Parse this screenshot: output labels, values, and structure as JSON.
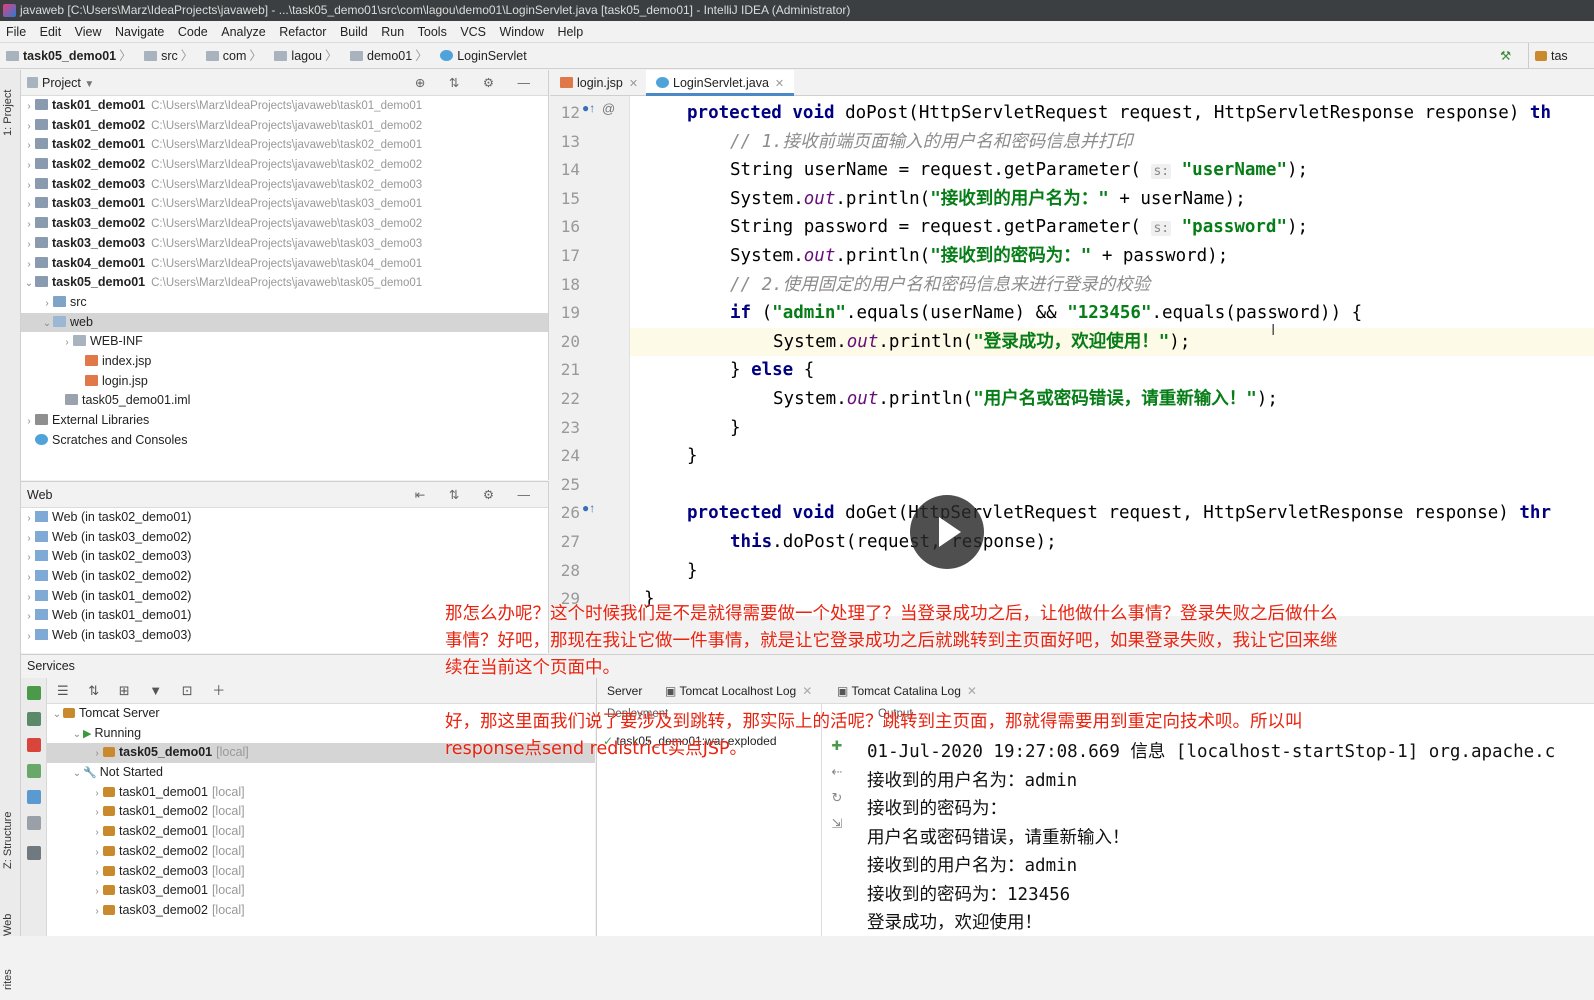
{
  "window": {
    "title": "javaweb [C:\\Users\\Marz\\IdeaProjects\\javaweb] - ...\\task05_demo01\\src\\com\\lagou\\demo01\\LoginServlet.java [task05_demo01] - IntelliJ IDEA (Administrator)"
  },
  "menu": [
    "File",
    "Edit",
    "View",
    "Navigate",
    "Code",
    "Analyze",
    "Refactor",
    "Build",
    "Run",
    "Tools",
    "VCS",
    "Window",
    "Help"
  ],
  "breadcrumb": [
    "task05_demo01",
    "src",
    "com",
    "lagou",
    "demo01",
    "LoginServlet"
  ],
  "nav_right_label": "tas",
  "project_panel": {
    "title": "Project",
    "items": [
      {
        "name": "task01_demo01",
        "path": "C:\\Users\\Marz\\IdeaProjects\\javaweb\\task01_demo01"
      },
      {
        "name": "task01_demo02",
        "path": "C:\\Users\\Marz\\IdeaProjects\\javaweb\\task01_demo02"
      },
      {
        "name": "task02_demo01",
        "path": "C:\\Users\\Marz\\IdeaProjects\\javaweb\\task02_demo01"
      },
      {
        "name": "task02_demo02",
        "path": "C:\\Users\\Marz\\IdeaProjects\\javaweb\\task02_demo02"
      },
      {
        "name": "task02_demo03",
        "path": "C:\\Users\\Marz\\IdeaProjects\\javaweb\\task02_demo03"
      },
      {
        "name": "task03_demo01",
        "path": "C:\\Users\\Marz\\IdeaProjects\\javaweb\\task03_demo01"
      },
      {
        "name": "task03_demo02",
        "path": "C:\\Users\\Marz\\IdeaProjects\\javaweb\\task03_demo02"
      },
      {
        "name": "task03_demo03",
        "path": "C:\\Users\\Marz\\IdeaProjects\\javaweb\\task03_demo03"
      },
      {
        "name": "task04_demo01",
        "path": "C:\\Users\\Marz\\IdeaProjects\\javaweb\\task04_demo01"
      },
      {
        "name": "task05_demo01",
        "path": "C:\\Users\\Marz\\IdeaProjects\\javaweb\\task05_demo01"
      }
    ],
    "src": "src",
    "web": "web",
    "web_inf": "WEB-INF",
    "index_jsp": "index.jsp",
    "login_jsp": "login.jsp",
    "iml": "task05_demo01.iml",
    "external_libs": "External Libraries",
    "scratches": "Scratches and Consoles"
  },
  "web_panel": {
    "title": "Web",
    "items": [
      "Web (in task02_demo01)",
      "Web (in task03_demo02)",
      "Web (in task02_demo03)",
      "Web (in task02_demo02)",
      "Web (in task01_demo02)",
      "Web (in task01_demo01)",
      "Web (in task03_demo03)"
    ]
  },
  "side_labels": {
    "project": "1: Project",
    "structure": "Z: Structure",
    "web": "Web",
    "favorites": "rites"
  },
  "editor": {
    "tabs": [
      {
        "label": "login.jsp"
      },
      {
        "label": "LoginServlet.java"
      }
    ],
    "line_numbers": [
      "12",
      "13",
      "14",
      "15",
      "16",
      "17",
      "18",
      "19",
      "20",
      "21",
      "22",
      "23",
      "24",
      "25",
      "26",
      "27",
      "28",
      "29"
    ]
  },
  "services": {
    "title": "Services",
    "tomcat_server": "Tomcat Server",
    "running": "Running",
    "running_items": [
      {
        "name": "task05_demo01",
        "tag": "[local]"
      }
    ],
    "not_started": "Not Started",
    "not_started_items": [
      {
        "name": "task01_demo01",
        "tag": "[local]"
      },
      {
        "name": "task01_demo02",
        "tag": "[local]"
      },
      {
        "name": "task02_demo01",
        "tag": "[local]"
      },
      {
        "name": "task02_demo02",
        "tag": "[local]"
      },
      {
        "name": "task02_demo03",
        "tag": "[local]"
      },
      {
        "name": "task03_demo01",
        "tag": "[local]"
      },
      {
        "name": "task03_demo02",
        "tag": "[local]"
      }
    ],
    "tabs": [
      "Server",
      "Tomcat Localhost Log",
      "Tomcat Catalina Log"
    ],
    "deployment_label": "Deployment",
    "output_label": "Output",
    "deployment_item": "task05_demo01:war exploded",
    "output_lines": [
      "01-Jul-2020 19:27:08.669 信息 [localhost-startStop-1] org.apache.c",
      "接收到的用户名为：admin",
      "接收到的密码为：",
      "用户名或密码错误，请重新输入！",
      "接收到的用户名为：admin",
      "接收到的密码为：123456",
      "登录成功，欢迎使用！"
    ]
  },
  "subtitle": {
    "lines": [
      "那怎么办呢？这个时候我们是不是就得需要做一个处理了？当登录成功之后，让他做什么事情？登录失败之后做什么",
      "事情？好吧，那现在我让它做一件事情，就是让它登录成功之后就跳转到主页面好吧，如果登录失败，我让它回来继",
      "续在当前这个页面中。",
      "好，那这里面我们说了要涉及到跳转，那实际上的活呢？跳转到主页面，那就得需要用到重定向技术呗。所以叫",
      "response点send redistrict实点JSP。"
    ]
  },
  "colors": {
    "subtitle": "#e8230f",
    "keyword": "#000080",
    "string": "#067d17",
    "comment": "#8c8c8c"
  }
}
